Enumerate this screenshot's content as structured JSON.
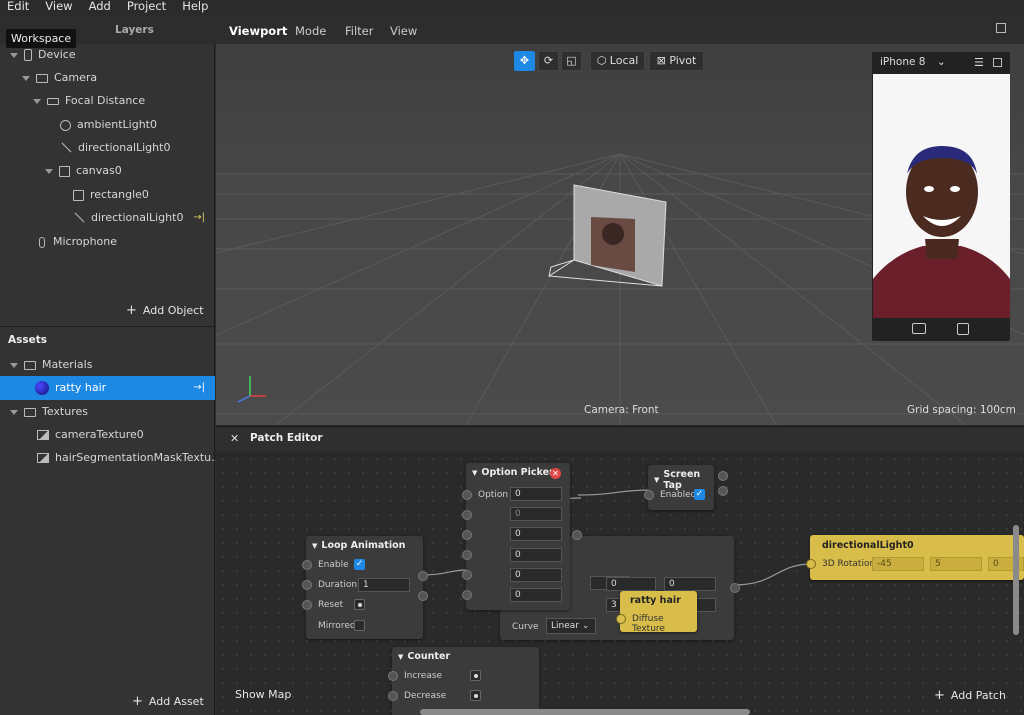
{
  "menu": [
    "Edit",
    "View",
    "Add",
    "Project",
    "Help"
  ],
  "left_tabs": {
    "workspace": "Workspace",
    "layers": "Layers"
  },
  "scene_tree": [
    {
      "label": "Device",
      "icon": "device-icon"
    },
    {
      "label": "Camera",
      "icon": "camera-icon"
    },
    {
      "label": "Focal Distance",
      "icon": "focal-distance-icon"
    },
    {
      "label": "ambientLight0",
      "icon": "ambient-light-icon"
    },
    {
      "label": "directionalLight0",
      "icon": "directional-light-icon"
    },
    {
      "label": "canvas0",
      "icon": "canvas-icon"
    },
    {
      "label": "rectangle0",
      "icon": "rectangle-icon"
    },
    {
      "label": "directionalLight0",
      "icon": "directional-light-icon"
    },
    {
      "label": "Microphone",
      "icon": "microphone-icon"
    }
  ],
  "add_object": "Add Object",
  "assets": {
    "header": "Assets",
    "items": [
      {
        "label": "Materials",
        "icon": "folder-icon"
      },
      {
        "label": "ratty hair",
        "icon": "material-sphere-icon"
      },
      {
        "label": "Textures",
        "icon": "folder-icon"
      },
      {
        "label": "cameraTexture0",
        "icon": "texture-icon"
      },
      {
        "label": "hairSegmentationMaskTextu...",
        "icon": "texture-icon"
      }
    ],
    "add_asset": "Add Asset"
  },
  "viewport": {
    "tabs": [
      "Viewport",
      "Mode",
      "Filter",
      "View"
    ],
    "toolbar": {
      "local": "Local",
      "pivot": "Pivot"
    },
    "device": "iPhone 8",
    "camera_label": "Camera: Front",
    "grid_label": "Grid spacing: 100cm"
  },
  "patch_editor": {
    "title": "Patch Editor",
    "show_map": "Show Map",
    "add_patch": "Add Patch",
    "nodes": {
      "option_picker": {
        "title": "Option Picker",
        "option_label": "Option",
        "values": [
          "0",
          "0",
          "0",
          "0",
          "0",
          "0"
        ]
      },
      "screen_tap": {
        "title": "Screen Tap",
        "enabled_label": "Enabled"
      },
      "loop_animation": {
        "title": "Loop Animation",
        "enable": "Enable",
        "duration": "Duration",
        "duration_value": "1",
        "reset": "Reset",
        "mirrored": "Mirrored"
      },
      "transition": {
        "curve_label": "Curve",
        "curve_value": "Linear",
        "values": [
          "0",
          "0",
          "3"
        ]
      },
      "ratty_hair": {
        "title": "ratty hair",
        "port": "Diffuse Texture"
      },
      "directional_light": {
        "title": "directionalLight0",
        "port": "3D Rotation",
        "values": [
          "-45",
          "5",
          "0"
        ]
      },
      "counter": {
        "title": "Counter",
        "increase": "Increase",
        "decrease": "Decrease"
      }
    }
  },
  "colors": {
    "accent": "#1e88e5",
    "patch_yellow": "#d8bd4a"
  }
}
